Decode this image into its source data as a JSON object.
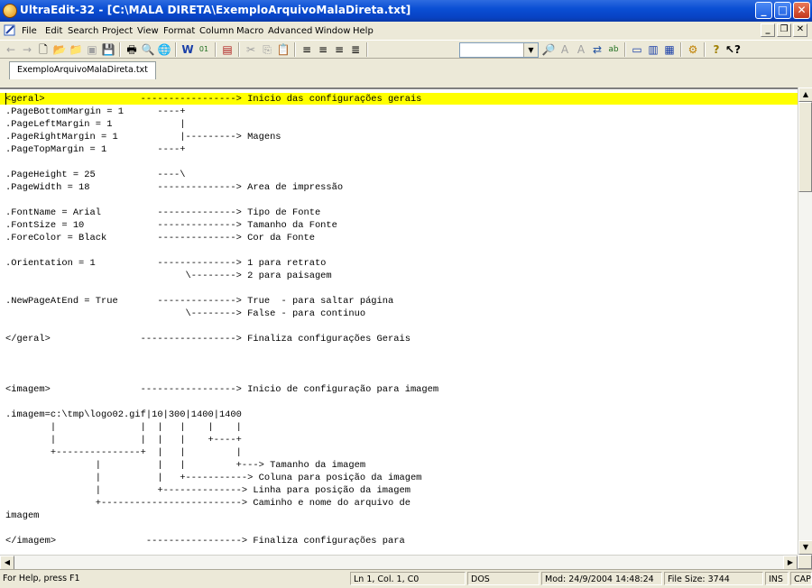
{
  "window": {
    "title": "UltraEdit-32 - [C:\\MALA DIRETA\\ExemploArquivoMalaDireta.txt]"
  },
  "menu": [
    "File",
    "Edit",
    "Search",
    "Project",
    "View",
    "Format",
    "Column",
    "Macro",
    "Advanced",
    "Window",
    "Help"
  ],
  "tab": {
    "label": "ExemploArquivoMalaDireta.txt"
  },
  "editor": {
    "highlight_color": "#ffff00",
    "lines": [
      "<geral>                 -----------------> Inicio das configurações gerais",
      ".PageBottomMargin = 1      ----+",
      ".PageLeftMargin = 1            |",
      ".PageRightMargin = 1           |---------> Magens",
      ".PageTopMargin = 1         ----+",
      "",
      ".PageHeight = 25           ----\\",
      ".PageWidth = 18            --------------> Area de impressão",
      "",
      ".FontName = Arial          --------------> Tipo de Fonte",
      ".FontSize = 10             --------------> Tamanho da Fonte",
      ".ForeColor = Black         --------------> Cor da Fonte",
      "",
      ".Orientation = 1           --------------> 1 para retrato",
      "                                \\--------> 2 para paisagem",
      "",
      ".NewPageAtEnd = True       --------------> True  - para saltar página",
      "                                \\--------> False - para continuo",
      "",
      "</geral>                -----------------> Finaliza configurações Gerais",
      "",
      "",
      "",
      "<imagem>                -----------------> Inicio de configuração para imagem",
      "",
      ".imagem=c:\\tmp\\logo02.gif|10|300|1400|1400",
      "        |               |  |   |    |    |",
      "        |               |  |   |    +----+",
      "        +---------------+  |   |         |",
      "                |          |   |         +---> Tamanho da imagem",
      "                |          |   +-----------> Coluna para posição da imagem",
      "                |          +--------------> Linha para posição da imagem",
      "                +-------------------------> Caminho e nome do arquivo de",
      "imagem",
      "",
      "</imagem>                -----------------> Finaliza configurações para"
    ]
  },
  "status": {
    "help": "For Help, press F1",
    "position": "Ln 1, Col. 1, C0",
    "format": "DOS",
    "modified": "Mod: 24/9/2004 14:48:24",
    "filesize": "File Size: 3744",
    "ins": "INS",
    "cap": "CAP"
  }
}
